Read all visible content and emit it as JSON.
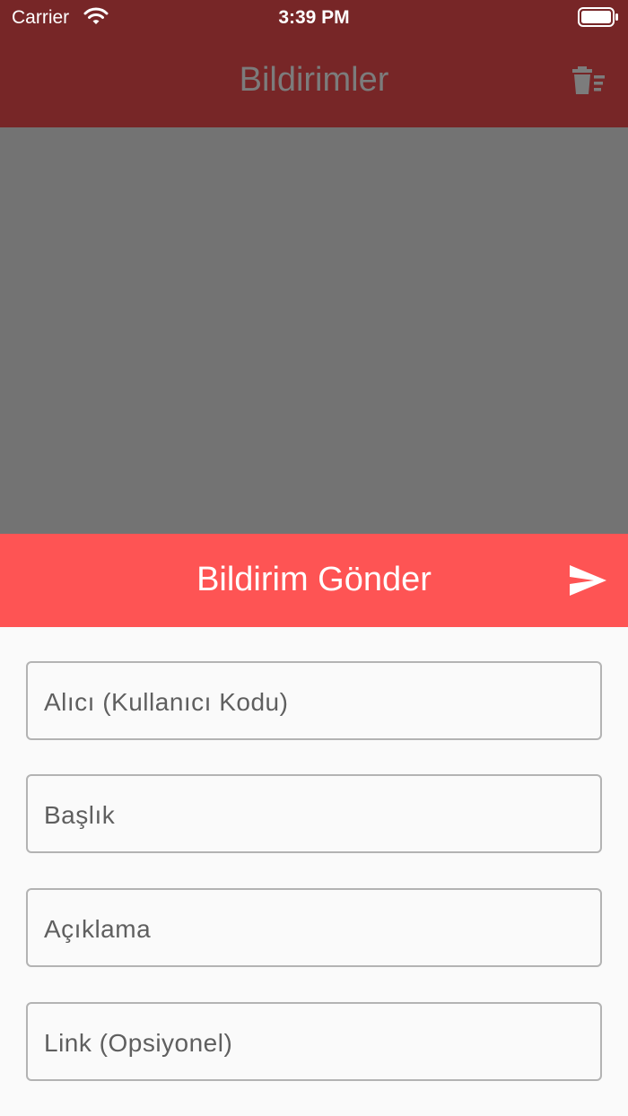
{
  "status_bar": {
    "carrier": "Carrier",
    "time": "3:39 PM"
  },
  "app_bar": {
    "title": "Bildirimler",
    "action_icon": "delete-sweep-icon"
  },
  "sheet": {
    "title": "Bildirim Gönder",
    "send_icon": "send-icon",
    "fields": [
      {
        "label": "Alıcı (Kullanıcı Kodu)"
      },
      {
        "label": "Başlık"
      },
      {
        "label": "Açıklama"
      },
      {
        "label": "Link (Opsiyonel)"
      }
    ]
  },
  "colors": {
    "app_bar_dimmed": "#772627",
    "scrim": "#737373",
    "sheet_header": "#fe5454",
    "background": "#fafafa",
    "field_border": "#b3b3b3"
  }
}
